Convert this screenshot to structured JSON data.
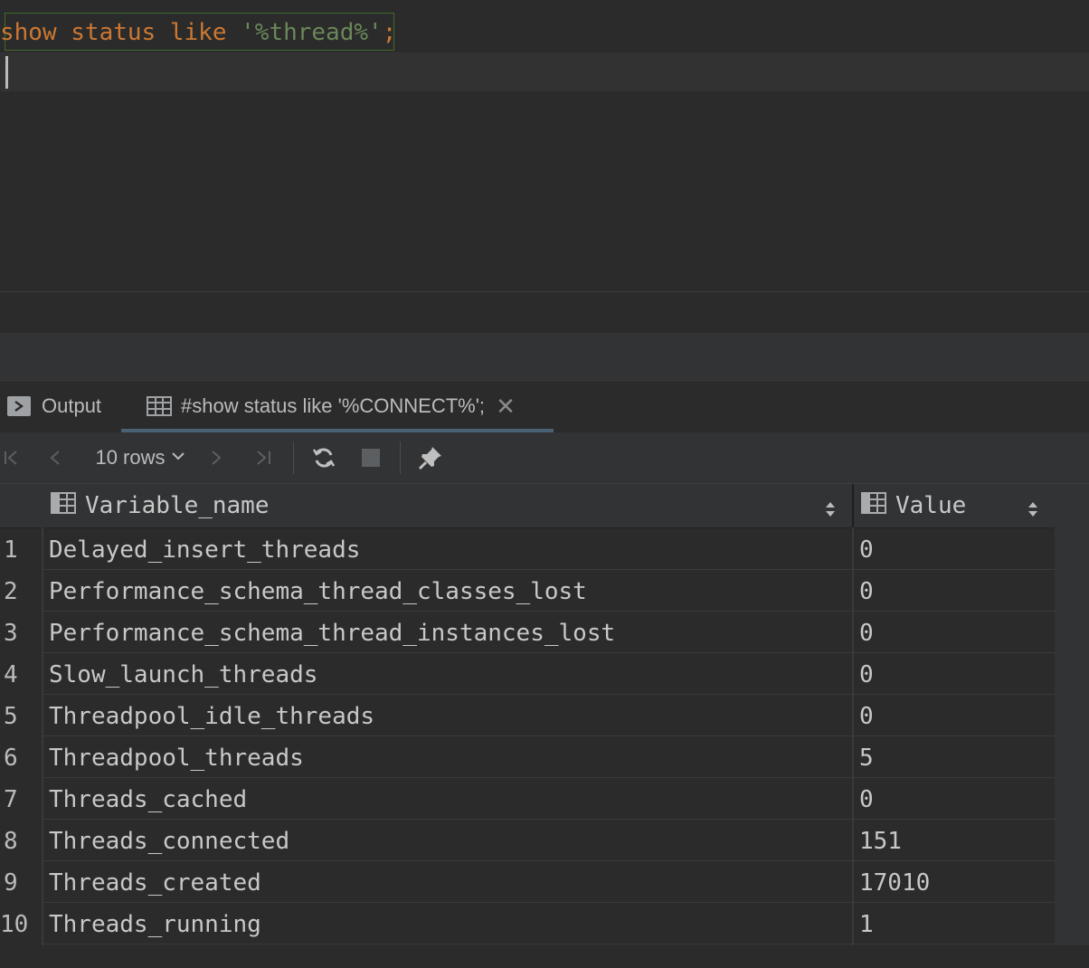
{
  "editor": {
    "keywords": [
      "show",
      "status",
      "like"
    ],
    "string_literal": "'%thread%'",
    "terminator": ";"
  },
  "tabs": [
    {
      "label": "Output",
      "icon": "console-icon"
    },
    {
      "label": "#show status like '%CONNECT%';",
      "icon": "table-icon",
      "active": true
    }
  ],
  "toolbar": {
    "rows_label": "10 rows"
  },
  "grid": {
    "columns": [
      "Variable_name",
      "Value"
    ],
    "rows": [
      {
        "n": "1",
        "name": "Delayed_insert_threads",
        "value": "0"
      },
      {
        "n": "2",
        "name": "Performance_schema_thread_classes_lost",
        "value": "0"
      },
      {
        "n": "3",
        "name": "Performance_schema_thread_instances_lost",
        "value": "0"
      },
      {
        "n": "4",
        "name": "Slow_launch_threads",
        "value": "0"
      },
      {
        "n": "5",
        "name": "Threadpool_idle_threads",
        "value": "0"
      },
      {
        "n": "6",
        "name": "Threadpool_threads",
        "value": "5"
      },
      {
        "n": "7",
        "name": "Threads_cached",
        "value": "0"
      },
      {
        "n": "8",
        "name": "Threads_connected",
        "value": "151"
      },
      {
        "n": "9",
        "name": "Threads_created",
        "value": "17010"
      },
      {
        "n": "10",
        "name": "Threads_running",
        "value": "1"
      }
    ]
  },
  "colors": {
    "keyword": "#cc7832",
    "string": "#6a8759",
    "background": "#2b2b2b",
    "text": "#bbbbbb"
  }
}
